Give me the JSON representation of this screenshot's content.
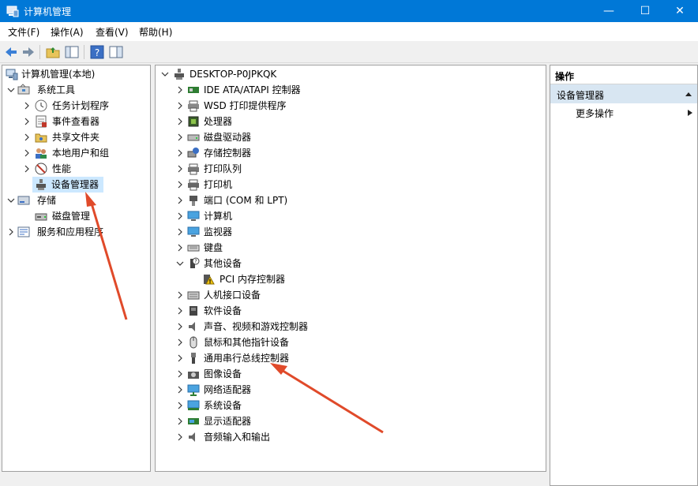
{
  "window": {
    "title": "计算机管理",
    "min_glyph": "—",
    "max_glyph": "☐",
    "close_glyph": "✕"
  },
  "menu": {
    "file": "文件(F)",
    "action": "操作(A)",
    "view": "查看(V)",
    "help": "帮助(H)"
  },
  "left_tree": {
    "root": "计算机管理(本地)",
    "system_tools": "系统工具",
    "task_scheduler": "任务计划程序",
    "event_viewer": "事件查看器",
    "shared_folders": "共享文件夹",
    "local_users": "本地用户和组",
    "performance": "性能",
    "device_manager": "设备管理器",
    "storage": "存储",
    "disk_management": "磁盘管理",
    "services_apps": "服务和应用程序"
  },
  "device_tree": {
    "computer_name": "DESKTOP-P0JPKQK",
    "categories": [
      "IDE ATA/ATAPI 控制器",
      "WSD 打印提供程序",
      "处理器",
      "磁盘驱动器",
      "存储控制器",
      "打印队列",
      "打印机",
      "端口 (COM 和 LPT)",
      "计算机",
      "监视器",
      "键盘",
      "其他设备",
      "人机接口设备",
      "软件设备",
      "声音、视频和游戏控制器",
      "鼠标和其他指针设备",
      "通用串行总线控制器",
      "图像设备",
      "网络适配器",
      "系统设备",
      "显示适配器",
      "音频输入和输出"
    ],
    "other_device_child": "PCI 内存控制器"
  },
  "actions": {
    "header": "操作",
    "section": "设备管理器",
    "more": "更多操作"
  },
  "colors": {
    "titlebar": "#0078d7",
    "selection": "#cce8ff",
    "arrow": "#e04a2a"
  }
}
